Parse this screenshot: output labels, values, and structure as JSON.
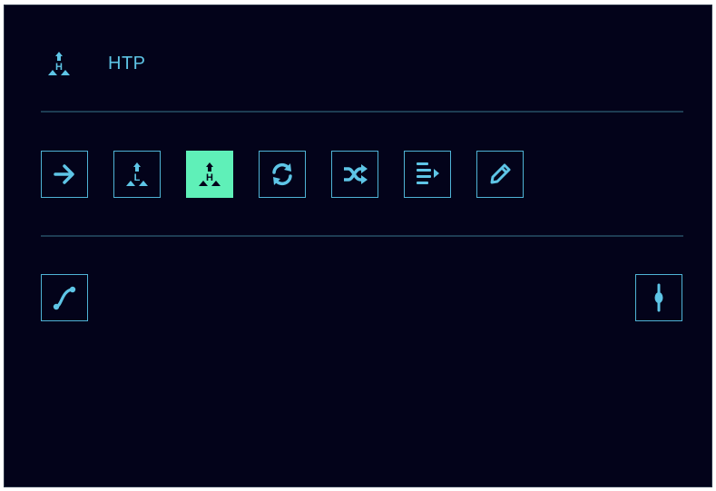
{
  "header": {
    "title": "HTP",
    "icon": "htp-icon"
  },
  "toolbar": {
    "active_tool": "htp",
    "tools": [
      {
        "name": "arrow-right-icon"
      },
      {
        "name": "ltp-icon"
      },
      {
        "name": "htp-icon"
      },
      {
        "name": "refresh-icon"
      },
      {
        "name": "shuffle-icon"
      },
      {
        "name": "list-play-icon"
      },
      {
        "name": "pencil-icon"
      }
    ]
  },
  "bottom_tools": [
    {
      "name": "curve-icon"
    },
    {
      "name": "vertical-marker-icon"
    }
  ],
  "colors": {
    "panel_bg": "#03031a",
    "accent": "#4fb3d6",
    "active": "#5ff0b8",
    "divider": "#1d3c52"
  }
}
